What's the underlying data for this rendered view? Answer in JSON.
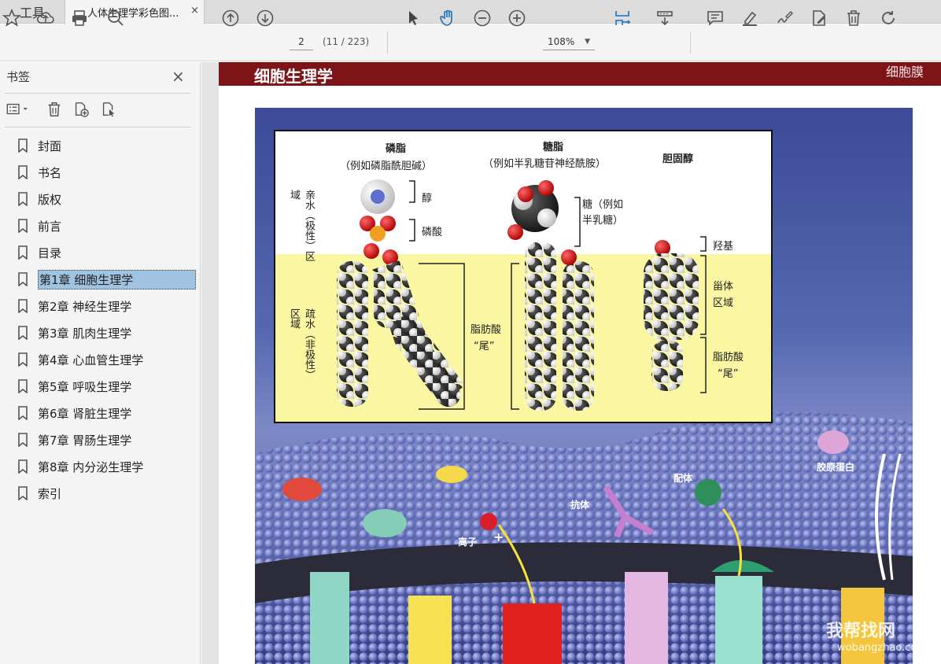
{
  "tabs": {
    "tools": "工具",
    "document": "人体生理学彩色图...",
    "close": "×"
  },
  "toolbar": {
    "page_current": "2",
    "page_count": "(11 / 223)",
    "zoom": "108%",
    "icons": [
      "star-icon",
      "upload-icon",
      "print-icon",
      "search-zoom-icon",
      "up-arrow-icon",
      "down-arrow-icon",
      "select-cursor-icon",
      "hand-icon",
      "zoom-out-icon",
      "zoom-in-icon",
      "fit-page-icon",
      "scroll-mode-icon",
      "comment-icon",
      "highlight-icon",
      "sign-icon",
      "edit-pdf-icon",
      "delete-icon",
      "rotate-icon"
    ]
  },
  "sidebar": {
    "title": "书签",
    "close": "×",
    "items": [
      {
        "label": "封面"
      },
      {
        "label": "书名"
      },
      {
        "label": "版权"
      },
      {
        "label": "前言"
      },
      {
        "label": "目录"
      },
      {
        "label": "第1章  细胞生理学",
        "selected": true
      },
      {
        "label": "第2章  神经生理学"
      },
      {
        "label": "第3章  肌肉生理学"
      },
      {
        "label": "第4章  心血管生理学"
      },
      {
        "label": "第5章  呼吸生理学"
      },
      {
        "label": "第6章  肾脏生理学"
      },
      {
        "label": "第7章  胃肠生理学"
      },
      {
        "label": "第8章  内分泌生理学"
      },
      {
        "label": "索引"
      }
    ]
  },
  "page": {
    "banner_title": "细胞生理学",
    "banner_right": "细胞膜",
    "figure": {
      "phospholipid": "磷脂",
      "phospholipid_eg": "（例如磷脂酰胆碱）",
      "glycolipid": "糖脂",
      "glycolipid_eg": "（例如半乳糖苷神经酰胺）",
      "cholesterol": "胆固醇",
      "hydrophilic": "亲水（极性）区域",
      "hydrophobic": "疏水（非极性）区域",
      "alcohol": "醇",
      "phosphate": "磷酸",
      "sugar": "糖（例如",
      "sugar2": "半乳糖）",
      "hydroxyl": "羟基",
      "steroid": "甾体",
      "steroid2": "区域",
      "fatty_tail_a": "脂肪酸",
      "fatty_tail_b": "“尾”",
      "fatty_tail2_a": "脂肪酸",
      "fatty_tail2_b": "“尾”",
      "ligand": "配体",
      "collagen": "胶原蛋白",
      "antibody": "抗体",
      "ion": "离子",
      "plus": "+"
    },
    "watermark": "我帮找网",
    "watermark_url": "wobangzhao.com"
  }
}
